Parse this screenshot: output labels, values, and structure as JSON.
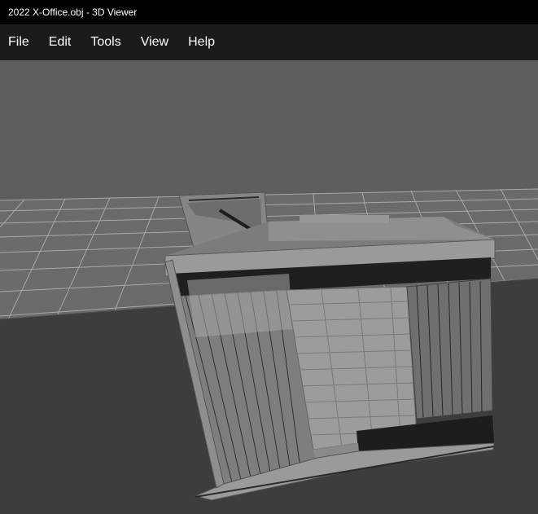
{
  "window": {
    "title": "2022 X-Office.obj - 3D Viewer"
  },
  "menu": {
    "items": [
      {
        "label": "File",
        "name": "menu-file"
      },
      {
        "label": "Edit",
        "name": "menu-edit"
      },
      {
        "label": "Tools",
        "name": "menu-tools"
      },
      {
        "label": "View",
        "name": "menu-view"
      },
      {
        "label": "Help",
        "name": "menu-help"
      }
    ]
  },
  "viewport": {
    "background_color": "#5e5e5e",
    "grid_color": "#b5b5b5",
    "ground_color": "#3c3c3c",
    "model_color": "#8a8a8a",
    "grid_visible": true
  }
}
